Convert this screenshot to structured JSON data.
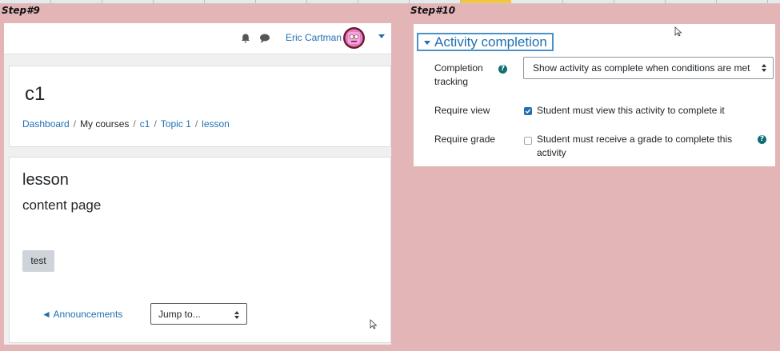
{
  "step_labels": {
    "left": "Step#9",
    "right": "Step#10"
  },
  "left": {
    "navbar": {
      "bell_icon": "bell-icon",
      "chat_icon": "chat-icon",
      "username": "Eric Cartman"
    },
    "course": {
      "title": "c1",
      "breadcrumb": [
        {
          "label": "Dashboard",
          "link": true
        },
        {
          "label": "My courses",
          "link": false
        },
        {
          "label": "c1",
          "link": true
        },
        {
          "label": "Topic 1",
          "link": true
        },
        {
          "label": "lesson",
          "link": true
        }
      ]
    },
    "lesson": {
      "title": "lesson",
      "content_heading": "content page",
      "test_button": "test",
      "prev_link": "◄ Announcements",
      "jump_select": "Jump to..."
    }
  },
  "right": {
    "section_title": "Activity completion",
    "completion_tracking": {
      "label": "Completion tracking",
      "value": "Show activity as complete when conditions are met"
    },
    "require_view": {
      "label": "Require view",
      "checkbox_label": "Student must view this activity to complete it",
      "checked": true
    },
    "require_grade": {
      "label": "Require grade",
      "checkbox_label": "Student must receive a grade to complete this activity",
      "checked": false
    }
  },
  "colors": {
    "link": "#1f6fb2",
    "background": "#e4b5b7",
    "help": "#0f6e74"
  }
}
